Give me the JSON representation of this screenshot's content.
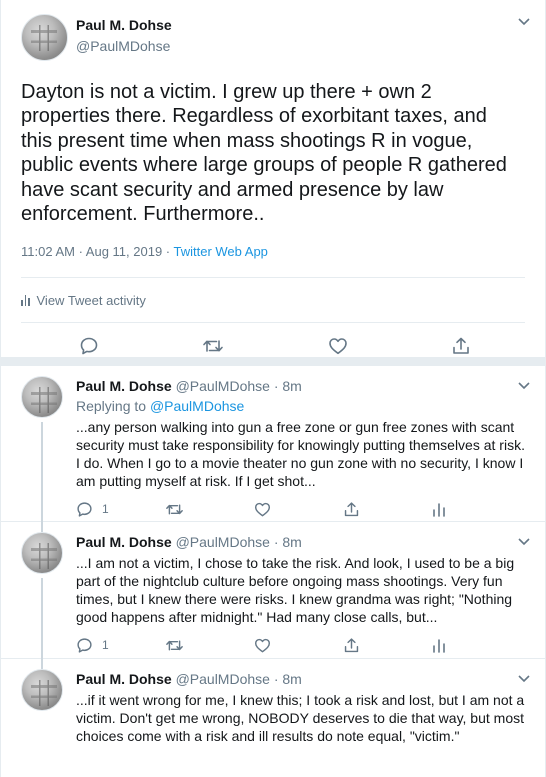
{
  "main_tweet": {
    "name": "Paul M. Dohse",
    "handle": "@PaulMDohse",
    "text": "Dayton is not a victim. I grew up there + own 2 properties there. Regardless of exorbitant taxes, and this present time when mass shootings R in vogue, public events where large groups of people R gathered have scant security and armed presence by law enforcement. Furthermore..",
    "timestamp": "11:02 AM · Aug 11, 2019 · ",
    "source": "Twitter Web App",
    "activity_label": "View Tweet activity",
    "icons": [
      "reply-icon",
      "retweet-icon",
      "like-icon",
      "share-icon"
    ]
  },
  "replies": [
    {
      "name": "Paul M. Dohse",
      "handle": "@PaulMDohse",
      "time": " · 8m",
      "replying_prefix": "Replying to ",
      "replying_to": "@PaulMDohse",
      "text": "...any person walking into gun a free zone or gun free zones with scant security must take responsibility for knowingly putting themselves at risk. I do. When I go to a movie theater no gun zone with no security, I know I am putting myself at risk. If I get shot...",
      "reply_count": "1"
    },
    {
      "name": "Paul M. Dohse",
      "handle": "@PaulMDohse",
      "time": " · 8m",
      "text": "...I am not a victim, I chose to take the risk. And look, I used to be a big part of the nightclub culture before ongoing mass shootings. Very fun times, but I knew there were risks. I knew grandma was right; \"Nothing good happens after midnight.\" Had many close calls, but...",
      "reply_count": "1"
    },
    {
      "name": "Paul M. Dohse",
      "handle": "@PaulMDohse",
      "time": " · 8m",
      "text": "...if it went wrong for me, I knew this; I took a risk and lost, but I am not a victim. Don't get me wrong, NOBODY deserves to die that way, but most choices come with a risk and ill results do note equal, \"victim.\""
    }
  ],
  "colors": {
    "text": "#14171a",
    "secondary": "#657786",
    "link": "#1b95e0",
    "border": "#e6ecf0"
  }
}
